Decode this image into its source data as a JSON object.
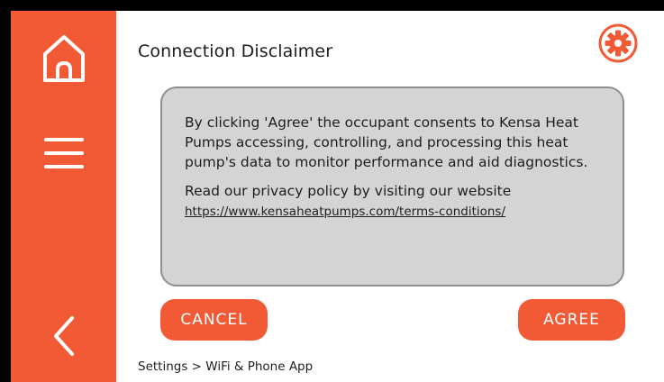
{
  "sidebar": {
    "icons": [
      "home-icon",
      "menu-icon",
      "back-icon"
    ],
    "color": "#f15a35"
  },
  "header": {
    "title": "Connection Disclaimer",
    "settings_icon": "gear-icon"
  },
  "notice": {
    "body": "By clicking 'Agree' the occupant consents to Kensa Heat Pumps accessing, controlling, and processing this heat pump's data to monitor performance and aid diagnostics.",
    "privacy_text": "Read our privacy policy by visiting our website",
    "link": "https://www.kensaheatpumps.com/terms-conditions/"
  },
  "actions": {
    "cancel_label": "CANCEL",
    "agree_label": "AGREE"
  },
  "breadcrumb": "Settings > WiFi & Phone App",
  "colors": {
    "accent": "#f15a35",
    "notice_bg": "#d4d4d4",
    "notice_border": "#8f8f8f",
    "frame": "#000000"
  }
}
